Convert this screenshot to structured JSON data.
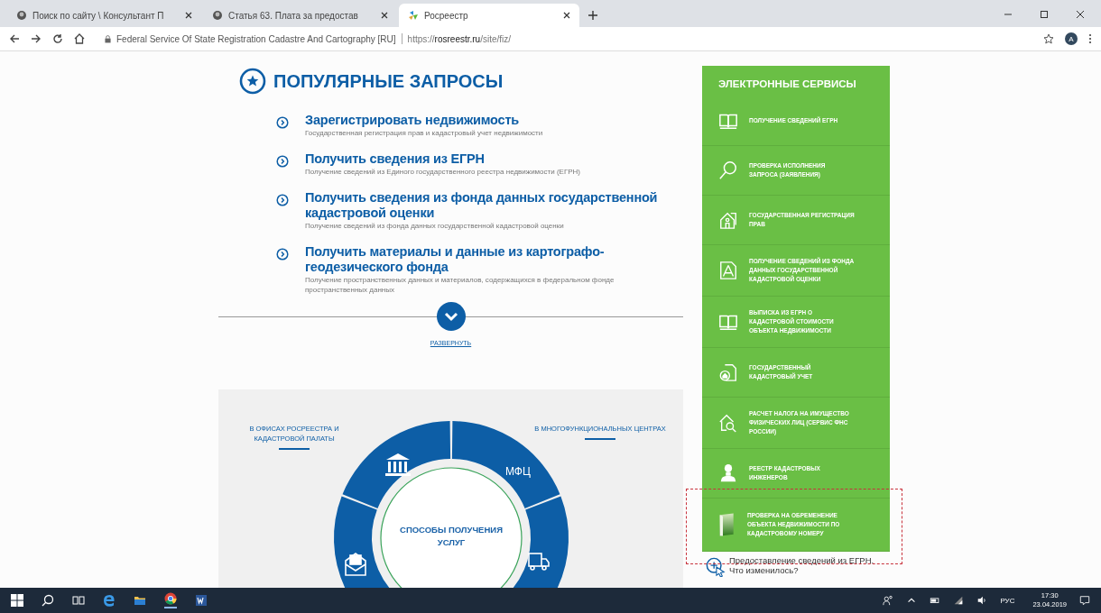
{
  "browser": {
    "tabs": [
      {
        "title": "Поиск по сайту \\ Консультант П",
        "selected": false
      },
      {
        "title": "Статья 63. Плата за предостав",
        "selected": false
      },
      {
        "title": "Росреестр",
        "selected": true
      }
    ],
    "site_name": "Federal Service Of State Registration Cadastre And Cartography [RU]",
    "url": "https://**rosreestr.ru**/site/fiz/",
    "profile": "A"
  },
  "popular": {
    "title": "ПОПУЛЯРНЫЕ ЗАПРОСЫ",
    "items": [
      {
        "title": "Зарегистрировать недвижимость",
        "subtitle": "Государственная регистрация прав и кадастровый учет недвижимости"
      },
      {
        "title": "Получить сведения из ЕГРН",
        "subtitle": "Получение сведений из Единого государственного реестра недвижимости (ЕГРН)"
      },
      {
        "title": "Получить сведения из фонда данных государственной кадастровой оценки",
        "subtitle": "Получение сведений из фонда данных государственной кадастровой оценки"
      },
      {
        "title": "Получить материалы и данные из картографо-геодезического фонда",
        "subtitle": "Получение пространственных данных и материалов, содержащихся в федеральном фонде пространственных данных"
      }
    ],
    "expand": "РАЗВЕРНУТЬ"
  },
  "ways": {
    "left_label": "В ОФИСАХ РОСРЕЕСТРА И КАДАСТРОВОЙ ПАЛАТЫ",
    "right_label": "В МНОГОФУНКЦИОНАЛЬНЫХ ЦЕНТРАХ",
    "segment_label": "МФЦ",
    "center": "СПОСОБЫ ПОЛУЧЕНИЯ УСЛУГ"
  },
  "services": {
    "title": "ЭЛЕКТРОННЫЕ СЕРВИСЫ",
    "items": [
      {
        "label": "ПОЛУЧЕНИЕ СВЕДЕНИЙ ЕГРН"
      },
      {
        "label": "ПРОВЕРКА ИСПОЛНЕНИЯ ЗАПРОСА (ЗАЯВЛЕНИЯ)"
      },
      {
        "label": "ГОСУДАРСТВЕННАЯ РЕГИСТРАЦИЯ ПРАВ"
      },
      {
        "label": "ПОЛУЧЕНИЕ СВЕДЕНИЙ ИЗ ФОНДА ДАННЫХ ГОСУДАРСТВЕННОЙ КАДАСТРОВОЙ ОЦЕНКИ"
      },
      {
        "label": "ВЫПИСКА ИЗ ЕГРН О КАДАСТРОВОЙ СТОИМОСТИ ОБЪЕКТА НЕДВИЖИМОСТИ"
      },
      {
        "label": "ГОСУДАРСТВЕННЫЙ КАДАСТРОВЫЙ УЧЕТ"
      },
      {
        "label": "РАСЧЕТ НАЛОГА НА ИМУЩЕСТВО ФИЗИЧЕСКИХ ЛИЦ (СЕРВИС ФНС РОССИИ)"
      },
      {
        "label": "РЕЕСТР КАДАСТРОВЫХ ИНЖЕНЕРОВ"
      },
      {
        "label": "ПРОВЕРКА НА ОБРЕМЕНЕНИЕ ОБЪЕКТА НЕДВИЖИМОСТИ ПО КАДАСТРОВОМУ НОМЕРУ"
      }
    ],
    "news_link": "Предоставление сведений из ЕГРН. Что изменилось?"
  },
  "taskbar": {
    "language": "РУС",
    "time": "17:30",
    "date": "23.04.2019"
  }
}
